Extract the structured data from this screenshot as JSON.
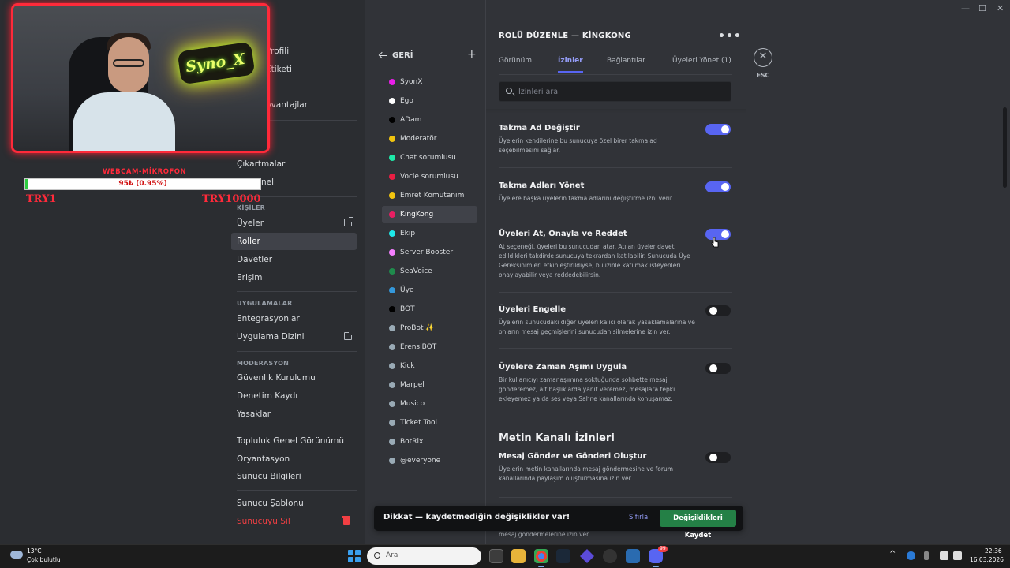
{
  "webcam": {
    "sign_text": "Syno_X",
    "donation_title": "WEBCAM-MİKROFON",
    "donation_progress_text": "95₺ (0.95%)",
    "donation_progress": 0.0095,
    "donation_min": "TRY1",
    "donation_max": "TRY10000"
  },
  "settings_nav": {
    "items": [
      {
        "label": "Profili"
      },
      {
        "label": "Etiketi"
      },
      {
        "label": "Avantajları"
      },
      {
        "label": "Çıkartmalar"
      },
      {
        "label": "neli"
      }
    ],
    "people_header": "KİŞİLER",
    "people": [
      {
        "label": "Üyeler",
        "external": true
      },
      {
        "label": "Roller",
        "active": true
      },
      {
        "label": "Davetler"
      },
      {
        "label": "Erişim"
      }
    ],
    "apps_header": "UYGULAMALAR",
    "apps": [
      {
        "label": "Entegrasyonlar"
      },
      {
        "label": "Uygulama Dizini",
        "external": true
      }
    ],
    "moderation_header": "MODERASYON",
    "moderation": [
      {
        "label": "Güvenlik Kurulumu"
      },
      {
        "label": "Denetim Kaydı"
      },
      {
        "label": "Yasaklar"
      }
    ],
    "community": [
      {
        "label": "Topluluk Genel Görünümü"
      },
      {
        "label": "Oryantasyon"
      },
      {
        "label": "Sunucu Bilgileri"
      }
    ],
    "template": "Sunucu Şablonu",
    "delete": "Sunucuyu Sil"
  },
  "roles": {
    "back_label": "GERİ",
    "add_label": "+",
    "list": [
      {
        "name": "SyonX",
        "color": "#e91ee9"
      },
      {
        "name": "Ego",
        "color": "#ffffff"
      },
      {
        "name": "ADam",
        "color": "#000000"
      },
      {
        "name": "Moderatör",
        "color": "#f1c40f"
      },
      {
        "name": "Chat sorumlusu",
        "color": "#1ee9a8"
      },
      {
        "name": "Vocie sorumlusu",
        "color": "#e91e43"
      },
      {
        "name": "Emret Komutanım",
        "color": "#f1c40f"
      },
      {
        "name": "KingKong",
        "color": "#e91e63",
        "active": true
      },
      {
        "name": "Ekip",
        "color": "#1ee9e9"
      },
      {
        "name": "Server Booster",
        "color": "#f47fff"
      },
      {
        "name": "SeaVoice",
        "color": "#1f8b4c"
      },
      {
        "name": "Üye",
        "color": "#3498db"
      },
      {
        "name": "BOT",
        "color": "#000000"
      },
      {
        "name": "ProBot ✨",
        "color": "#99aab5"
      },
      {
        "name": "ErensiBOT",
        "color": "#99aab5"
      },
      {
        "name": "Kick",
        "color": "#99aab5"
      },
      {
        "name": "Marpel",
        "color": "#99aab5"
      },
      {
        "name": "Musico",
        "color": "#99aab5"
      },
      {
        "name": "Ticket Tool",
        "color": "#99aab5"
      },
      {
        "name": "BotRix",
        "color": "#99aab5"
      },
      {
        "name": "@everyone",
        "color": "#99aab5"
      }
    ]
  },
  "edit": {
    "title": "ROLÜ DÜZENLE — KİNGKONG",
    "more": "•••",
    "tabs": [
      {
        "label": "Görünüm"
      },
      {
        "label": "İzinler",
        "active": true
      },
      {
        "label": "Bağlantılar"
      },
      {
        "label": "Üyeleri Yönet (1)"
      }
    ],
    "search_placeholder": "İzinleri ara",
    "permissions": [
      {
        "title": "Takma Ad Değiştir",
        "desc": "Üyelerin kendilerine bu sunucuya özel birer takma ad seçebilmesini sağlar.",
        "on": true
      },
      {
        "title": "Takma Adları Yönet",
        "desc": "Üyelere başka üyelerin takma adlarını değiştirme izni verir.",
        "on": true
      },
      {
        "title": "Üyeleri At, Onayla ve Reddet",
        "desc": "At seçeneği, üyeleri bu sunucudan atar. Atılan üyeler davet edildikleri takdirde sunucuya tekrardan katılabilir. Sunucuda Üye Gereksinimleri etkinleştirildiyse, bu izinle katılmak isteyenleri onaylayabilir veya reddedebilirsin.",
        "on": true
      },
      {
        "title": "Üyeleri Engelle",
        "desc": "Üyelerin sunucudaki diğer üyeleri kalıcı olarak yasaklamalarına ve onların mesaj geçmişlerini sunucudan silmelerine izin ver.",
        "on": false
      },
      {
        "title": "Üyelere Zaman Aşımı Uygula",
        "desc": "Bir kullanıcıyı zamanaşımına soktuğunda sohbette mesaj gönderemez, alt başlıklarda yanıt veremez, mesajlara tepki ekleyemez ya da ses veya Sahne kanallarında konuşamaz.",
        "on": false
      }
    ],
    "section_title": "Metin Kanalı İzinleri",
    "text_permissions": [
      {
        "title": "Mesaj Gönder ve Gönderi Oluştur",
        "desc": "Üyelerin metin kanallarında mesaj göndermesine ve forum kanallarında paylaşım oluşturmasına izin ver.",
        "on": false
      }
    ],
    "hidden_desc": "mesaj göndermelerine izin ver.",
    "close_label": "ESC"
  },
  "unsaved": {
    "message": "Dikkat — kaydetmediğin değişiklikler var!",
    "reset": "Sıfırla",
    "save": "Değişiklikleri Kaydet"
  },
  "taskbar": {
    "temp": "13°C",
    "weather": "Çok bulutlu",
    "search": "Ara",
    "time": "22:36",
    "date": "16.03.2026",
    "discord_badge": "99"
  }
}
